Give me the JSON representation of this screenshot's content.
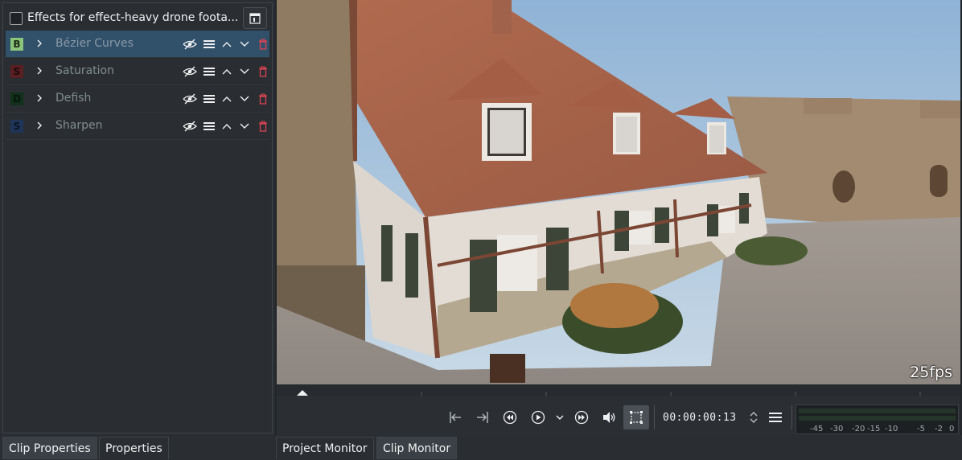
{
  "effects_panel": {
    "title": "Effects for effect-heavy drone foota...",
    "effects": [
      {
        "badge": "B",
        "badge_bg": "#8bc57b",
        "badge_fg": "#1b2a15",
        "name": "Bézier Curves",
        "selected": true
      },
      {
        "badge": "S",
        "badge_bg": "#5a1f22",
        "badge_fg": "#1c0a0b",
        "name": "Saturation",
        "selected": false
      },
      {
        "badge": "D",
        "badge_bg": "#10301a",
        "badge_fg": "#07140b",
        "name": "Defish",
        "selected": false
      },
      {
        "badge": "S",
        "badge_bg": "#1f3558",
        "badge_fg": "#0a1222",
        "name": "Sharpen",
        "selected": false
      }
    ]
  },
  "left_tabs": [
    "Clip Properties",
    "Properties"
  ],
  "monitor": {
    "fps_label": "25fps",
    "timecode": "00:00:00:13",
    "vu_scale": [
      "-45",
      "-30",
      "-20",
      "-15",
      "-10",
      "-5",
      "-2",
      "0"
    ]
  },
  "monitor_tabs": [
    "Project Monitor",
    "Clip Monitor"
  ],
  "colors": {
    "accent_selected": "#31506a",
    "delete_icon": "#da4453"
  }
}
